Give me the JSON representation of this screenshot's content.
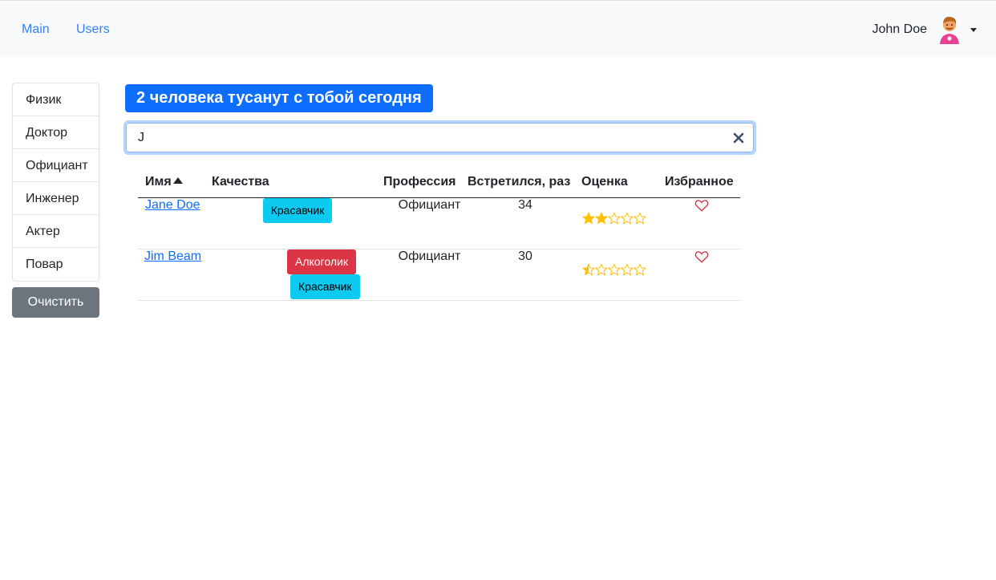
{
  "nav": {
    "links": [
      {
        "label": "Main"
      },
      {
        "label": "Users"
      }
    ],
    "user_name": "John Doe"
  },
  "professions": [
    "Физик",
    "Доктор",
    "Официант",
    "Инженер",
    "Актер",
    "Повар"
  ],
  "clear_button": "Очистить",
  "party_title": "2 человека тусанут с тобой сегодня",
  "search": {
    "value": "J",
    "placeholder": ""
  },
  "table": {
    "headers": {
      "name": "Имя",
      "qualities": "Качества",
      "profession": "Профессия",
      "meetings": "Встретился, раз",
      "rating": "Оценка",
      "bookmark": "Избранное"
    },
    "rows": [
      {
        "name": "Jane Doe",
        "qualities": [
          {
            "label": "Красавчик",
            "color": "#0dcaf0"
          }
        ],
        "profession": "Официант",
        "meetings": "34",
        "rating": 2,
        "bookmark": false
      },
      {
        "name": "Jim Beam",
        "qualities": [
          {
            "label": "Алкоголик",
            "color": "#dc3545"
          },
          {
            "label": "Красавчик",
            "color": "#0dcaf0"
          }
        ],
        "profession": "Официант",
        "meetings": "30",
        "rating": 0.5,
        "bookmark": false
      }
    ]
  },
  "colors": {
    "primary": "#0d6efd",
    "star": "#ffc107",
    "heart": "#dc3545",
    "secondary": "#6c757d"
  },
  "icons": {
    "sort": "caret-up-icon",
    "clear": "close-icon",
    "rating": "star-icon",
    "bookmark": "heart-icon",
    "user_menu": "chevron-down-icon"
  }
}
